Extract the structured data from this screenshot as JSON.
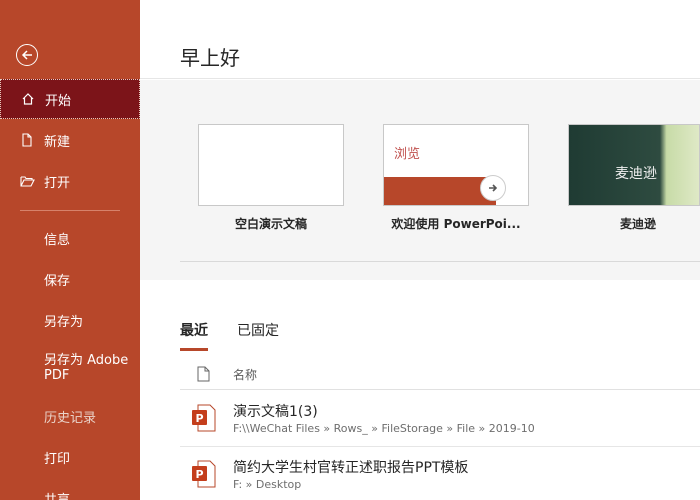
{
  "sidebar": {
    "back_icon": "back-arrow-icon",
    "items": [
      {
        "label": "开始",
        "icon": "home-icon",
        "active": true
      },
      {
        "label": "新建",
        "icon": "new-document-icon"
      },
      {
        "label": "打开",
        "icon": "open-folder-icon"
      },
      {
        "label": "信息"
      },
      {
        "label": "保存"
      },
      {
        "label": "另存为"
      },
      {
        "label": "另存为 Adobe PDF"
      },
      {
        "label": "历史记录"
      },
      {
        "label": "打印"
      },
      {
        "label": "共享"
      }
    ]
  },
  "main": {
    "greeting": "早上好",
    "templates": [
      {
        "label": "空白演示文稿"
      },
      {
        "label": "欢迎使用 PowerPoi...",
        "thumb_text": "浏览"
      },
      {
        "label": "麦迪逊",
        "thumb_text": "麦迪逊"
      }
    ],
    "tabs": [
      {
        "label": "最近",
        "active": true
      },
      {
        "label": "已固定"
      }
    ],
    "column_header": "名称",
    "files": [
      {
        "name": "演示文稿1(3)",
        "path": "F:\\\\WeChat Files » Rows_ » FileStorage » File » 2019-10"
      },
      {
        "name": "简约大学生村官转正述职报告PPT模板",
        "path": "F: » Desktop"
      }
    ]
  },
  "colors": {
    "accent": "#b7472a",
    "active_nav": "#7c1419",
    "gallery_bg": "#f5f5f5"
  }
}
